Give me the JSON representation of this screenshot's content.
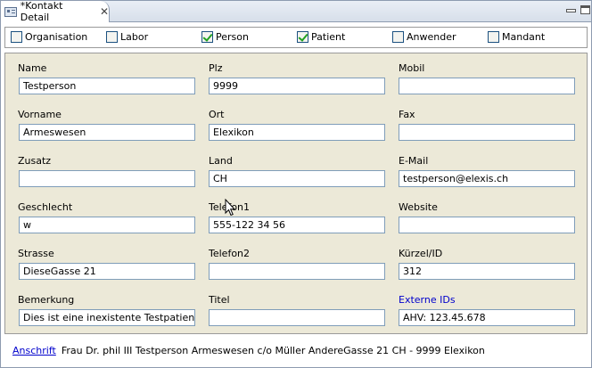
{
  "tab": {
    "title": "*Kontakt Detail",
    "close": "✕"
  },
  "types": [
    {
      "label": "Organisation",
      "checked": false
    },
    {
      "label": "Labor",
      "checked": false
    },
    {
      "label": "Person",
      "checked": true
    },
    {
      "label": "Patient",
      "checked": true
    },
    {
      "label": "Anwender",
      "checked": false
    },
    {
      "label": "Mandant",
      "checked": false
    }
  ],
  "fields": {
    "name": {
      "label": "Name",
      "value": "Testperson"
    },
    "plz": {
      "label": "Plz",
      "value": "9999"
    },
    "mobil": {
      "label": "Mobil",
      "value": ""
    },
    "vorname": {
      "label": "Vorname",
      "value": "Armeswesen"
    },
    "ort": {
      "label": "Ort",
      "value": "Elexikon"
    },
    "fax": {
      "label": "Fax",
      "value": ""
    },
    "zusatz": {
      "label": "Zusatz",
      "value": ""
    },
    "land": {
      "label": "Land",
      "value": "CH"
    },
    "email": {
      "label": "E-Mail",
      "value": "testperson@elexis.ch"
    },
    "geschlecht": {
      "label": "Geschlecht",
      "value": "w"
    },
    "telefon1": {
      "label": "Telefon1",
      "value": "555-122 34 56"
    },
    "website": {
      "label": "Website",
      "value": ""
    },
    "strasse": {
      "label": "Strasse",
      "value": "DieseGasse 21"
    },
    "telefon2": {
      "label": "Telefon2",
      "value": ""
    },
    "kuerzel": {
      "label": "Kürzel/ID",
      "value": "312"
    },
    "bemerkung": {
      "label": "Bemerkung",
      "value": "Dies ist eine inexistente Testpatientin"
    },
    "titel": {
      "label": "Titel",
      "value": ""
    },
    "externe_ids": {
      "label": "Externe IDs",
      "value": "AHV: 123.45.678"
    }
  },
  "footer": {
    "link": "Anschrift",
    "text": "Frau Dr. phil III Testperson Armeswesen c/o Müller AndereGasse 21 CH - 9999 Elexikon"
  },
  "colors": {
    "link": "#0000cc",
    "panel": "#ece9d8",
    "check": "#21a121"
  }
}
